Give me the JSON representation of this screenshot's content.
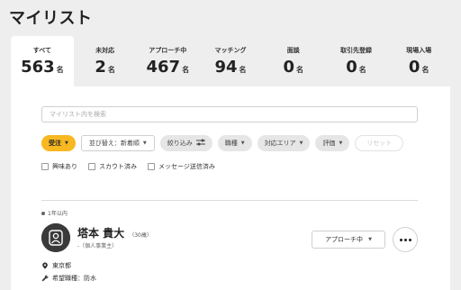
{
  "page": {
    "title": "マイリスト"
  },
  "tabs": [
    {
      "label": "すべて",
      "count": "563",
      "unit": "名"
    },
    {
      "label": "未対応",
      "count": "2",
      "unit": "名"
    },
    {
      "label": "アプローチ中",
      "count": "467",
      "unit": "名"
    },
    {
      "label": "マッチング",
      "count": "94",
      "unit": "名"
    },
    {
      "label": "面談",
      "count": "0",
      "unit": "名"
    },
    {
      "label": "取引先登録",
      "count": "0",
      "unit": "名"
    },
    {
      "label": "現場入場",
      "count": "0",
      "unit": "名"
    }
  ],
  "search": {
    "placeholder": "マイリスト内を検索"
  },
  "filters": {
    "order_type": "受注",
    "sort": "並び替え：新着順",
    "narrow": "絞り込み",
    "job_type": "職種",
    "area": "対応エリア",
    "rating": "評価",
    "reset": "リセット"
  },
  "checkboxes": [
    {
      "label": "興味あり",
      "checked": false
    },
    {
      "label": "スカウト済み",
      "checked": false
    },
    {
      "label": "メッセージ送信済み",
      "checked": false
    }
  ],
  "candidate": {
    "recency": "1年以内",
    "name": "塔本 貴大",
    "age": "（30歳）",
    "subinfo": "-（個人事業主）",
    "status": "アプローチ中",
    "location": "東京都",
    "desired_job": "希望職種：防水"
  },
  "colors": {
    "accent": "#f7b821",
    "background": "#eeeeee",
    "panel": "#ffffff"
  }
}
